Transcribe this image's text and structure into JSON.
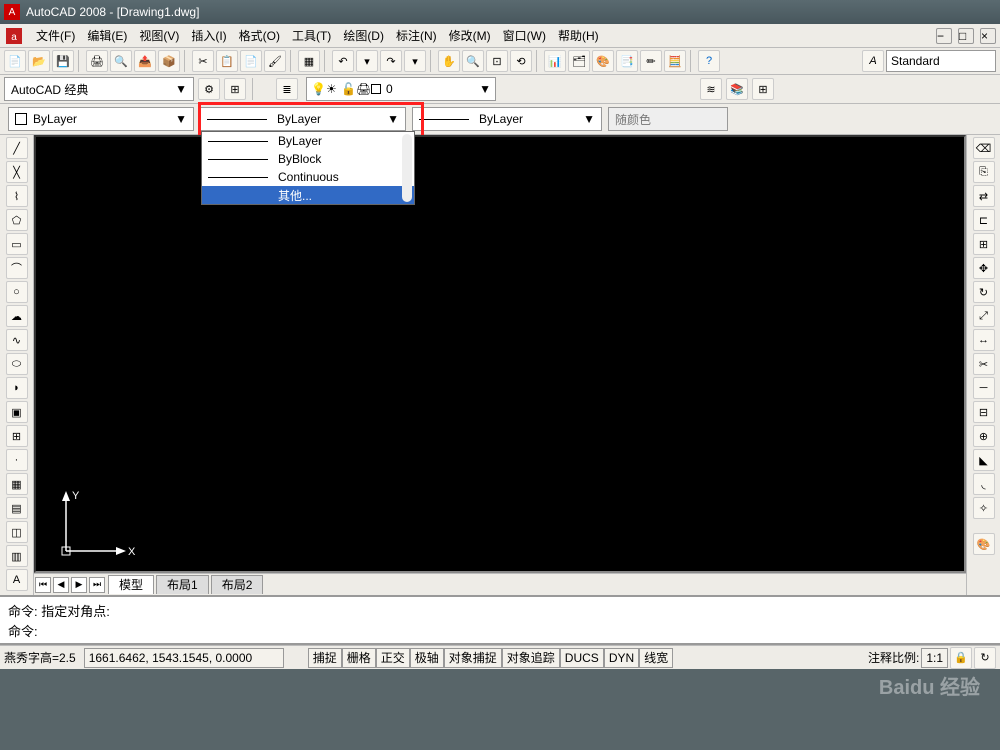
{
  "app": {
    "title": "AutoCAD 2008 - [Drawing1.dwg]"
  },
  "menu": {
    "items": [
      "文件(F)",
      "编辑(E)",
      "视图(V)",
      "插入(I)",
      "格式(O)",
      "工具(T)",
      "绘图(D)",
      "标注(N)",
      "修改(M)",
      "窗口(W)",
      "帮助(H)"
    ]
  },
  "workspace": {
    "current": "AutoCAD 经典"
  },
  "layer": {
    "current": "0"
  },
  "props": {
    "color": "ByLayer",
    "linetype": "ByLayer",
    "lineweight": "ByLayer",
    "plotstyle": "随颜色"
  },
  "linetype_dropdown": {
    "items": [
      "ByLayer",
      "ByBlock",
      "Continuous",
      "其他..."
    ],
    "selected_index": 3
  },
  "tooltip": {
    "text": "其他..."
  },
  "tabs": {
    "items": [
      "模型",
      "布局1",
      "布局2"
    ],
    "active": 0
  },
  "cmd": {
    "line1": "命令: 指定对角点:",
    "line2": "命令:"
  },
  "status": {
    "textheight": "燕秀字高=2.5",
    "coords": "1661.6462, 1543.1545, 0.0000",
    "toggles": [
      "捕捉",
      "栅格",
      "正交",
      "极轴",
      "对象捕捉",
      "对象追踪",
      "DUCS",
      "DYN",
      "线宽"
    ],
    "annoscale_label": "注释比例:",
    "annoscale": "1:1"
  },
  "textstyle": {
    "current": "Standard"
  },
  "ucs": {
    "x": "X",
    "y": "Y"
  }
}
